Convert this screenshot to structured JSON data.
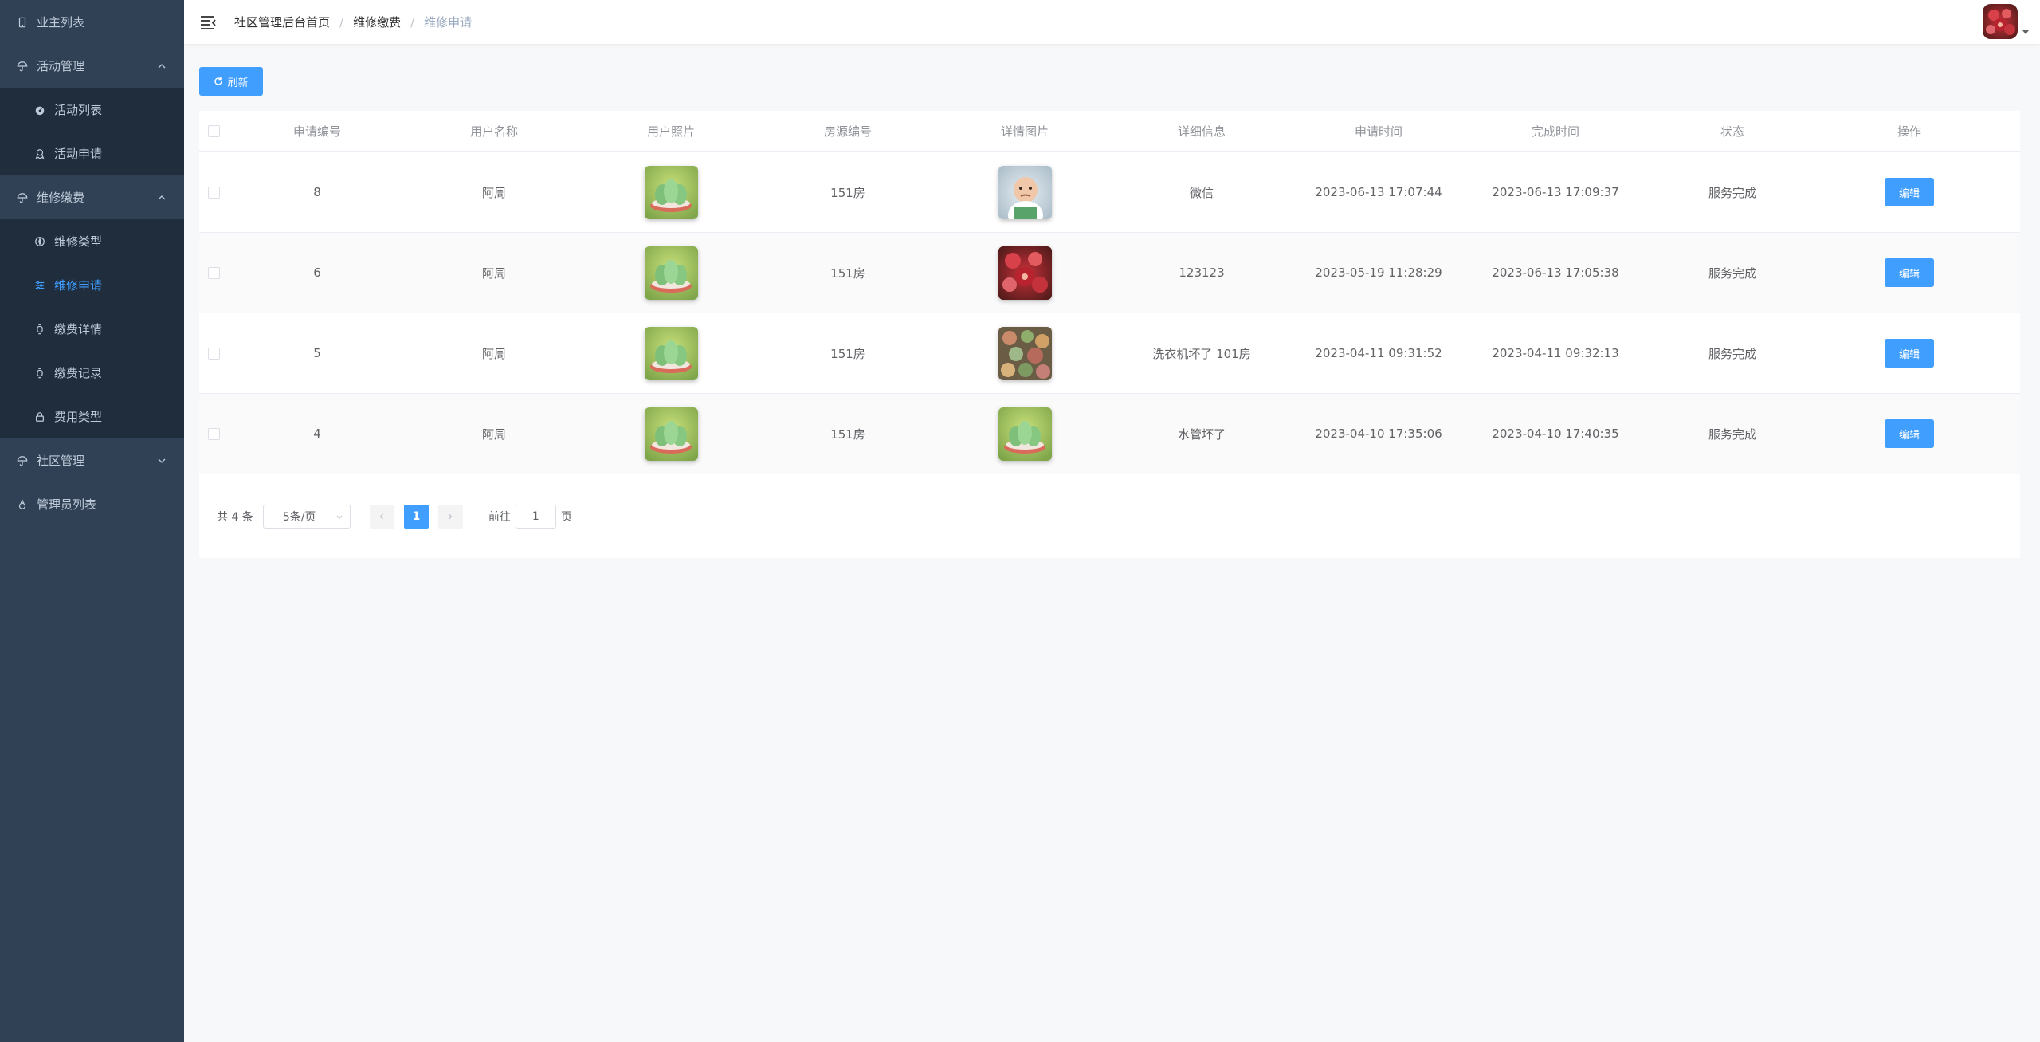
{
  "sidebar": {
    "items": [
      {
        "label": "业主列表",
        "icon": "tablet-icon"
      },
      {
        "label": "活动管理",
        "icon": "umbrella-icon",
        "expanded": true,
        "children": [
          {
            "label": "活动列表",
            "icon": "dashboard-icon"
          },
          {
            "label": "活动申请",
            "icon": "medal-icon"
          }
        ]
      },
      {
        "label": "维修缴费",
        "icon": "umbrella-icon",
        "expanded": true,
        "children": [
          {
            "label": "维修类型",
            "icon": "compass-icon"
          },
          {
            "label": "维修申请",
            "icon": "sliders-icon",
            "active": true
          },
          {
            "label": "缴费详情",
            "icon": "watch-icon"
          },
          {
            "label": "缴费记录",
            "icon": "watch-icon"
          },
          {
            "label": "费用类型",
            "icon": "lock-icon"
          }
        ]
      },
      {
        "label": "社区管理",
        "icon": "umbrella-icon",
        "expanded": false
      },
      {
        "label": "管理员列表",
        "icon": "user-icon"
      }
    ],
    "active_color": "#409eff"
  },
  "header": {
    "breadcrumb": [
      "社区管理后台首页",
      "维修缴费",
      "维修申请"
    ],
    "separator": "/"
  },
  "toolbar": {
    "refresh_label": "刷新"
  },
  "table": {
    "columns": [
      "申请编号",
      "用户名称",
      "用户照片",
      "房源编号",
      "详情图片",
      "详细信息",
      "申请时间",
      "完成时间",
      "状态",
      "操作"
    ],
    "rows": [
      {
        "id": "8",
        "user": "阿周",
        "user_photo": "succulent-green",
        "house": "151房",
        "detail_image": "baby",
        "info": "微信",
        "apply_time": "2023-06-13 17:07:44",
        "done_time": "2023-06-13 17:09:37",
        "status": "服务完成",
        "action": "编辑"
      },
      {
        "id": "6",
        "user": "阿周",
        "user_photo": "succulent-green",
        "house": "151房",
        "detail_image": "succulent-red",
        "info": "123123",
        "apply_time": "2023-05-19 11:28:29",
        "done_time": "2023-06-13 17:05:38",
        "status": "服务完成",
        "action": "编辑"
      },
      {
        "id": "5",
        "user": "阿周",
        "user_photo": "succulent-green",
        "house": "151房",
        "detail_image": "succulent-mixed",
        "info": "洗衣机坏了 101房",
        "apply_time": "2023-04-11 09:31:52",
        "done_time": "2023-04-11 09:32:13",
        "status": "服务完成",
        "action": "编辑"
      },
      {
        "id": "4",
        "user": "阿周",
        "user_photo": "succulent-green",
        "house": "151房",
        "detail_image": "succulent-green",
        "info": "水管坏了",
        "apply_time": "2023-04-10 17:35:06",
        "done_time": "2023-04-10 17:40:35",
        "status": "服务完成",
        "action": "编辑"
      }
    ]
  },
  "pagination": {
    "total_text": "共 4 条",
    "page_size": "5条/页",
    "current_page": "1",
    "goto_prefix": "前往",
    "goto_value": "1",
    "goto_suffix": "页"
  },
  "colors": {
    "sidebar_bg": "#304156",
    "submenu_bg": "#1f2d3d",
    "primary": "#409eff"
  }
}
